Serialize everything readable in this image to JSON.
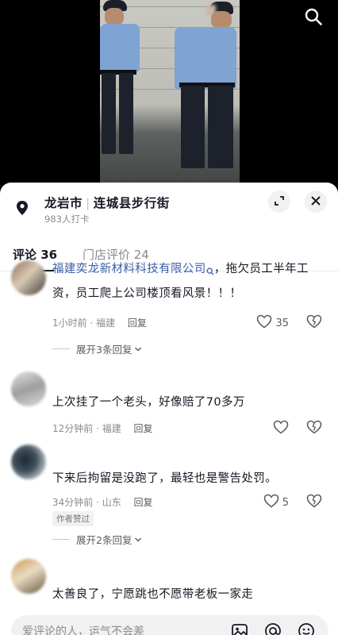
{
  "location": {
    "city": "龙岩市",
    "place": "连城县步行街",
    "checkins": "983人打卡"
  },
  "tabs": [
    {
      "label": "评论 36",
      "active": true
    },
    {
      "label": "门店评价 24",
      "active": false
    }
  ],
  "comments": [
    {
      "link_text": "福建奕龙新材料科技有限公司",
      "text": "，拖欠员工半年工资，员工爬上公司楼顶看风景！！！",
      "time": "1小时前 · 福建",
      "reply": "回复",
      "likes": "35",
      "expand": "展开3条回复"
    },
    {
      "text": "上次挂了一个老头，好像赔了70多万",
      "time": "12分钟前 · 福建",
      "reply": "回复",
      "likes": ""
    },
    {
      "text": "下来后拘留是没跑了，最轻也是警告处罚。",
      "time": "34分钟前 · 山东",
      "reply": "回复",
      "likes": "5",
      "badge": "作者赞过",
      "expand": "展开2条回复"
    },
    {
      "text": "太善良了，宁愿跳也不愿带老板一家走",
      "time": "",
      "reply": "",
      "likes": ""
    }
  ],
  "input": {
    "placeholder": "爱评论的人，运气不会差"
  },
  "icons": {
    "search": "search-icon",
    "location": "location-pin-icon",
    "expand": "expand-arrows-icon",
    "close": "close-icon",
    "like": "heart-outline-icon",
    "dislike": "broken-heart-icon",
    "image": "image-icon",
    "mention": "at-icon",
    "emoji": "emoji-icon"
  },
  "colors": {
    "link": "#3a5fa8",
    "muted": "#8a8b91",
    "text": "#161823"
  }
}
